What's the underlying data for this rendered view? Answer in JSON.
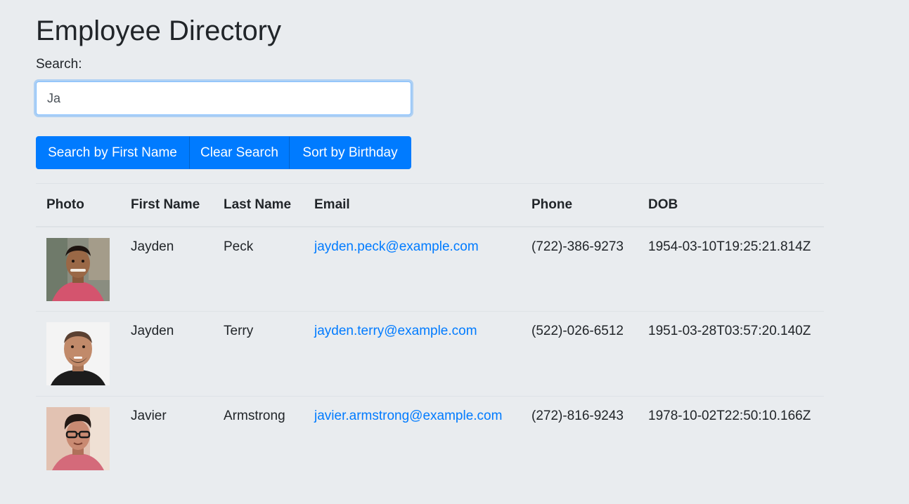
{
  "page": {
    "title": "Employee Directory"
  },
  "search": {
    "label": "Search:",
    "value": "Ja",
    "placeholder": ""
  },
  "buttons": {
    "search_first_name": "Search by First Name",
    "clear_search": "Clear Search",
    "sort_birthday": "Sort by Birthday"
  },
  "table": {
    "headers": [
      "Photo",
      "First Name",
      "Last Name",
      "Email",
      "Phone",
      "DOB"
    ],
    "rows": [
      {
        "first_name": "Jayden",
        "last_name": "Peck",
        "email": "jayden.peck@example.com",
        "phone": "(722)-386-9273",
        "dob": "1954-03-10T19:25:21.814Z"
      },
      {
        "first_name": "Jayden",
        "last_name": "Terry",
        "email": "jayden.terry@example.com",
        "phone": "(522)-026-6512",
        "dob": "1951-03-28T03:57:20.140Z"
      },
      {
        "first_name": "Javier",
        "last_name": "Armstrong",
        "email": "javier.armstrong@example.com",
        "phone": "(272)-816-9243",
        "dob": "1978-10-02T22:50:10.166Z"
      }
    ]
  },
  "colors": {
    "background": "#e9ecef",
    "primary": "#007bff",
    "link": "#007bff",
    "text": "#212529"
  }
}
